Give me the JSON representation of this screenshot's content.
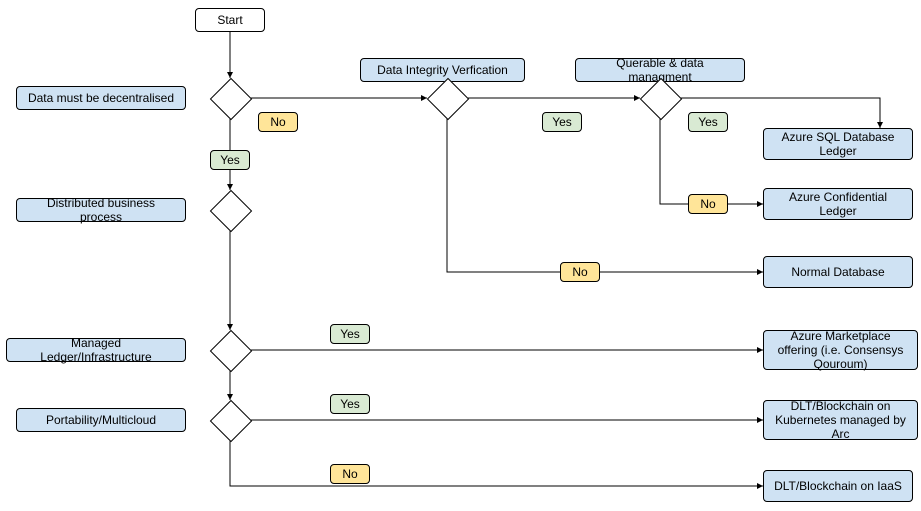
{
  "flow": {
    "start": "Start",
    "q1": "Data must be decentralised",
    "q2": "Data Integrity Verfication",
    "q3": "Querable & data managment",
    "q4": "Distributed business process",
    "q5": "Managed Ledger/Infrastructure",
    "q6": "Portability/Multicloud",
    "r1": "Azure SQL Database Ledger",
    "r2": "Azure Confidential Ledger",
    "r3": "Normal Database",
    "r4": "Azure Marketplace offering (i.e. Consensys Qouroum)",
    "r5": "DLT/Blockchain on Kubernetes managed by Arc",
    "r6": "DLT/Blockchain on IaaS",
    "yes": "Yes",
    "no": "No"
  }
}
